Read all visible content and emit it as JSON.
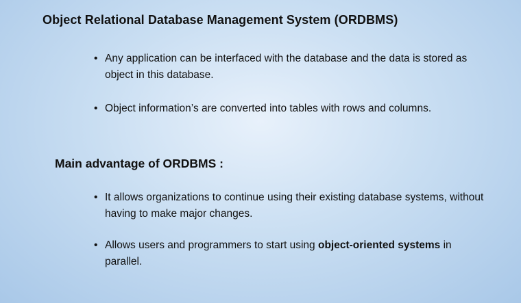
{
  "slide": {
    "title": "Object Relational Database Management System (ORDBMS)",
    "bullets_group1": [
      "Any application can be interfaced with the database and the data is stored as object in this database.",
      "Object information’s are converted into tables with rows and columns."
    ],
    "section_title": "Main advantage of ORDBMS :",
    "bullets_group2": [
      "It allows organizations to continue using their existing database systems, without having to make major changes."
    ],
    "bullet4": {
      "pre": "Allows users and programmers to start using ",
      "bold": "object-oriented systems",
      "post": " in parallel."
    },
    "bullet_symbol": "•"
  }
}
